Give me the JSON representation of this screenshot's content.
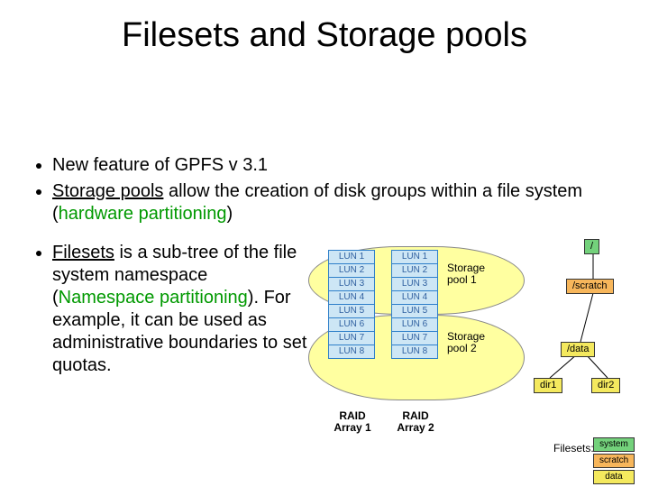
{
  "title": "Filesets and Storage pools",
  "bullets": {
    "b1": "New feature of GPFS v 3.1",
    "b2_pre": "Storage pools",
    "b2_post": " allow the creation of disk groups within a file system (",
    "b2_green": "hardware partitioning",
    "b2_close": ")",
    "b3_pre": "Filesets",
    "b3_post": " is a sub-tree of the file system namespace (",
    "b3_green": "Namespace partitioning",
    "b3_close": "). For example, it can be used as administrative boundaries to set quotas."
  },
  "luns": [
    "LUN 1",
    "LUN 2",
    "LUN 3",
    "LUN 4",
    "LUN 5",
    "LUN 6",
    "LUN 7",
    "LUN 8"
  ],
  "labels": {
    "sp1a": "Storage",
    "sp1b": "pool 1",
    "sp2a": "Storage",
    "sp2b": "pool 2",
    "ra1a": "RAID",
    "ra1b": "Array 1",
    "ra2a": "RAID",
    "ra2b": "Array 2",
    "filesets": "Filesets:"
  },
  "tree": {
    "root": "/",
    "scratch": "/scratch",
    "data": "/data",
    "dir1": "dir1",
    "dir2": "dir2"
  },
  "legend": {
    "system": "system",
    "scratch": "scratch",
    "data": "data"
  }
}
